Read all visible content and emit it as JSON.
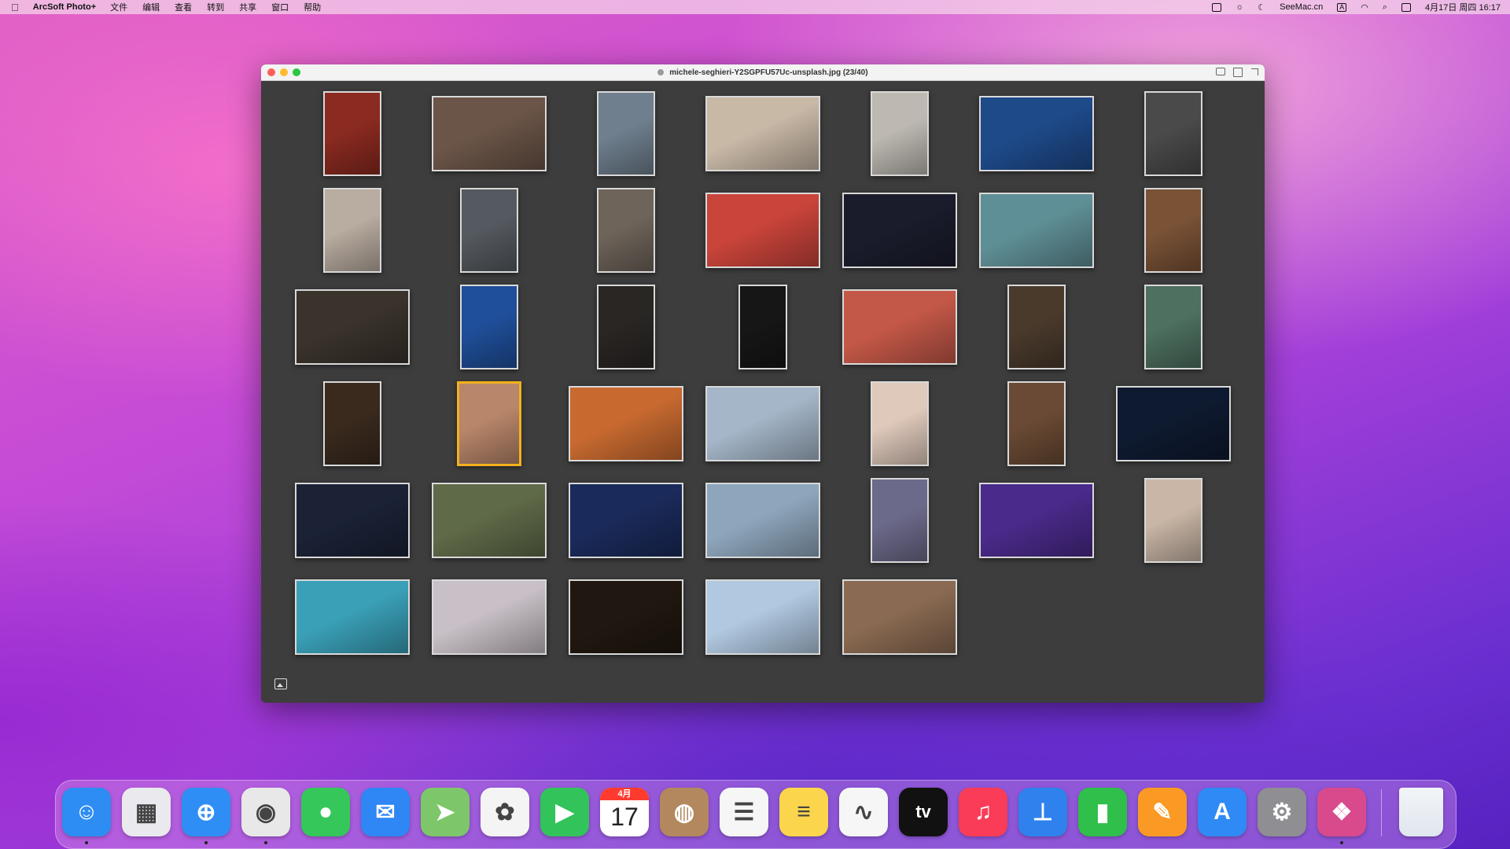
{
  "menubar": {
    "app_name": "ArcSoft Photo+",
    "items": [
      "文件",
      "编辑",
      "查看",
      "转到",
      "共享",
      "窗口",
      "帮助"
    ],
    "status": {
      "seemac": "SeeMac.cn",
      "input_badge": "A",
      "datetime": "4月17日 周四  16:17"
    }
  },
  "window": {
    "title": "michele-seghieri-Y2SGPFU57Uc-unsplash.jpg (23/40)"
  },
  "gallery": {
    "selected_index": 22,
    "thumbnails": [
      {
        "color": "#8a2a20"
      },
      {
        "color": "#6b5548"
      },
      {
        "color": "#6f7f8e"
      },
      {
        "color": "#c8b8a6"
      },
      {
        "color": "#bdb9b2"
      },
      {
        "color": "#1e4a8a"
      },
      {
        "color": "#4a4a4a"
      },
      {
        "color": "#b9aca0"
      },
      {
        "color": "#555a60"
      },
      {
        "color": "#6e645a"
      },
      {
        "color": "#c9443a"
      },
      {
        "color": "#1a1c2c"
      },
      {
        "color": "#5f8f96"
      },
      {
        "color": "#7a5236"
      },
      {
        "color": "#3a332c"
      },
      {
        "color": "#1f4f9a"
      },
      {
        "color": "#2a2624"
      },
      {
        "color": "#161616"
      },
      {
        "color": "#c45848"
      },
      {
        "color": "#4a3a2c"
      },
      {
        "color": "#4d7060"
      },
      {
        "color": "#3a2a1e"
      },
      {
        "color": "#b8866a"
      },
      {
        "color": "#c86a30"
      },
      {
        "color": "#a4b6c8"
      },
      {
        "color": "#dfc9bb"
      },
      {
        "color": "#6a4a34"
      },
      {
        "color": "#0e1a30"
      },
      {
        "color": "#1b2236"
      },
      {
        "color": "#5f6a48"
      },
      {
        "color": "#1a2a5a"
      },
      {
        "color": "#8ea6bc"
      },
      {
        "color": "#6c6a8a"
      },
      {
        "color": "#4a2a8a"
      },
      {
        "color": "#c9b6a6"
      },
      {
        "color": "#3aa0b8"
      },
      {
        "color": "#c8c0c6"
      },
      {
        "color": "#201810"
      },
      {
        "color": "#b0c8e0"
      },
      {
        "color": "#8a6a52"
      }
    ]
  },
  "dock": {
    "apps": [
      {
        "icon": "finder-icon",
        "color": "#2d8df3",
        "glyph": "☺",
        "running": true
      },
      {
        "icon": "launchpad-icon",
        "color": "#e9e9ee",
        "glyph": "▦",
        "running": false
      },
      {
        "icon": "safari-icon",
        "color": "#2f8ef5",
        "glyph": "⊕",
        "running": true
      },
      {
        "icon": "chrome-icon",
        "color": "#e8e8e8",
        "glyph": "◉",
        "running": true
      },
      {
        "icon": "messages-icon",
        "color": "#35c759",
        "glyph": "●",
        "running": false
      },
      {
        "icon": "mail-icon",
        "color": "#2f86f5",
        "glyph": "✉",
        "running": false
      },
      {
        "icon": "maps-icon",
        "color": "#7dc76a",
        "glyph": "➤",
        "running": false
      },
      {
        "icon": "photos-icon",
        "color": "#f4f4f4",
        "glyph": "✿",
        "running": false
      },
      {
        "icon": "facetime-icon",
        "color": "#32c35a",
        "glyph": "▶",
        "running": false
      },
      {
        "icon": "calendar-icon",
        "color": "#ffffff",
        "glyph": "",
        "running": false,
        "month": "4月",
        "day": "17"
      },
      {
        "icon": "contacts-icon",
        "color": "#b3885e",
        "glyph": "◍",
        "running": false
      },
      {
        "icon": "reminders-icon",
        "color": "#f6f6f6",
        "glyph": "☰",
        "running": false
      },
      {
        "icon": "notes-icon",
        "color": "#fbd54c",
        "glyph": "≡",
        "running": false
      },
      {
        "icon": "freeform-icon",
        "color": "#f6f6f6",
        "glyph": "∿",
        "running": false
      },
      {
        "icon": "appletv-icon",
        "color": "#111111",
        "glyph": "tv",
        "running": false
      },
      {
        "icon": "music-icon",
        "color": "#fb3c58",
        "glyph": "♫",
        "running": false
      },
      {
        "icon": "keynote-icon",
        "color": "#2f82ee",
        "glyph": "⊥",
        "running": false
      },
      {
        "icon": "numbers-icon",
        "color": "#2fbf4a",
        "glyph": "▮",
        "running": false
      },
      {
        "icon": "pages-icon",
        "color": "#fa9a24",
        "glyph": "✎",
        "running": false
      },
      {
        "icon": "appstore-icon",
        "color": "#2f8af5",
        "glyph": "A",
        "running": false
      },
      {
        "icon": "system-settings-icon",
        "color": "#8e8e93",
        "glyph": "⚙",
        "running": false
      },
      {
        "icon": "arcsoft-photo-icon",
        "color": "#d84a8c",
        "glyph": "❖",
        "running": true
      }
    ],
    "trash": {
      "icon": "trash-icon",
      "color": "#dfe6ee",
      "glyph": ""
    }
  }
}
